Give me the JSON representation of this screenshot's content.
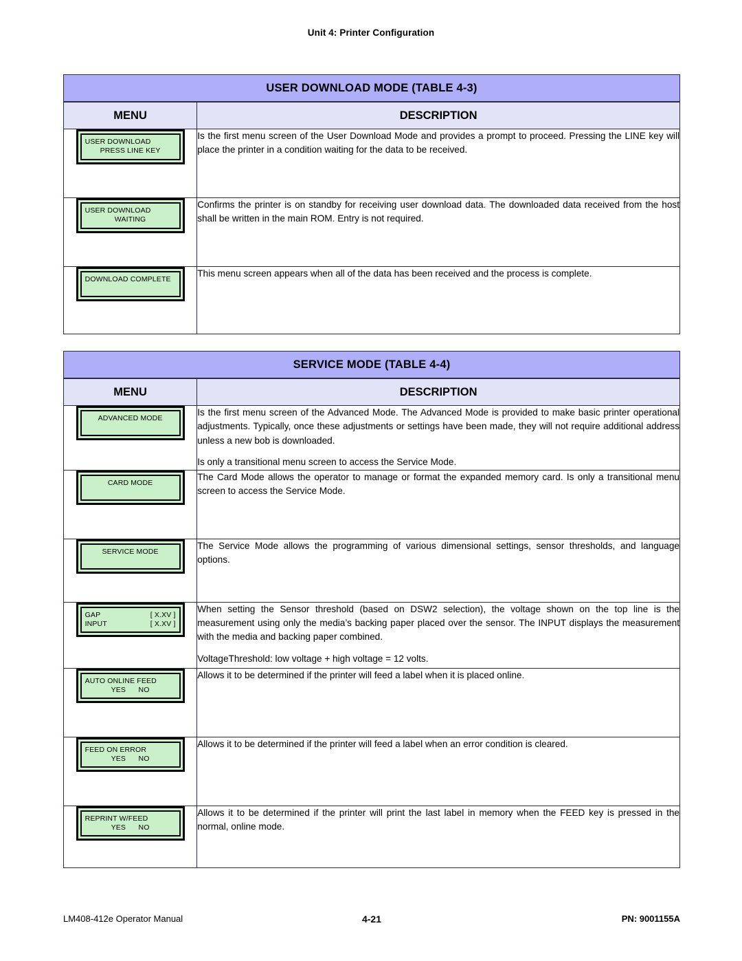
{
  "running_head": "Unit 4:  Printer Configuration",
  "colors": {
    "title_bar": "#aeaef9",
    "subhead": "#e3e3f8",
    "lcd_green": "#c9f0c9",
    "border": "#2b2b40"
  },
  "tables": [
    {
      "title": "USER DOWNLOAD MODE (TABLE 4-3)",
      "columns": {
        "menu": "MENU",
        "description": "DESCRIPTION"
      },
      "rows": [
        {
          "lcd": {
            "lines": [
              {
                "text": "USER DOWNLOAD",
                "align": "left"
              },
              {
                "text": "PRESS LINE KEY",
                "align": "center"
              }
            ]
          },
          "paragraphs": [
            "Is the first menu screen of the User Download Mode and provides a prompt to proceed. Pressing the LINE key will place the printer in a condition waiting for the data to be received."
          ]
        },
        {
          "lcd": {
            "lines": [
              {
                "text": "USER DOWNLOAD",
                "align": "left"
              },
              {
                "text": "WAITING",
                "align": "center"
              }
            ]
          },
          "paragraphs": [
            "Confirms the printer is on standby for receiving user download data. The downloaded data received from the host shall be written in the main ROM. Entry is not required."
          ]
        },
        {
          "lcd": {
            "lines": [
              {
                "text": "DOWNLOAD COMPLETE",
                "align": "left"
              },
              {
                "text": "",
                "align": "left"
              }
            ]
          },
          "paragraphs": [
            "This menu screen appears when all of the data has been received and the process is complete."
          ]
        }
      ]
    },
    {
      "title": "SERVICE MODE (TABLE 4-4)",
      "columns": {
        "menu": "MENU",
        "description": "DESCRIPTION"
      },
      "rows": [
        {
          "lcd": {
            "lines": [
              {
                "text": "ADVANCED MODE",
                "align": "center"
              },
              {
                "text": "",
                "align": "left"
              }
            ]
          },
          "paragraphs": [
            "Is the first menu screen of the Advanced Mode. The Advanced Mode is provided to make basic printer operational adjustments. Typically, once these adjustments or settings have been made, they will not require additional address unless a new bob is downloaded.",
            "Is only a transitional menu screen to access the Service Mode."
          ]
        },
        {
          "lcd": {
            "lines": [
              {
                "text": "CARD MODE",
                "align": "center"
              },
              {
                "text": "",
                "align": "left"
              }
            ]
          },
          "paragraphs": [
            "The Card Mode allows the operator to manage or format the expanded memory card. Is only a transitional menu screen to access the Service Mode."
          ]
        },
        {
          "lcd": {
            "lines": [
              {
                "text": "SERVICE MODE",
                "align": "center"
              },
              {
                "text": "",
                "align": "left"
              }
            ]
          },
          "paragraphs": [
            "The Service Mode allows the programming of various dimensional settings, sensor thresholds, and language options."
          ]
        },
        {
          "lcd": {
            "lines": [
              {
                "left": "GAP",
                "right": "[ X.XV ]",
                "align": "split"
              },
              {
                "left": "INPUT",
                "right": "[ X.XV ]",
                "align": "split"
              }
            ]
          },
          "paragraphs": [
            "When setting the Sensor threshold (based on DSW2 selection), the voltage shown on the top line is the measurement using only the media’s backing paper placed over the sensor. The INPUT displays the measurement with the media and backing paper combined.",
            "VoltageThreshold: low voltage + high voltage = 12 volts."
          ]
        },
        {
          "lcd": {
            "lines": [
              {
                "text": "AUTO ONLINE FEED",
                "align": "left"
              },
              {
                "text": "YES      NO",
                "align": "center"
              }
            ]
          },
          "paragraphs": [
            "Allows it to be determined if the printer will feed a label when it is placed online."
          ]
        },
        {
          "lcd": {
            "lines": [
              {
                "text": "FEED ON ERROR",
                "align": "left"
              },
              {
                "text": "YES      NO",
                "align": "center"
              }
            ]
          },
          "paragraphs": [
            "Allows it to be determined if the printer will feed a label when an error condition is cleared."
          ]
        },
        {
          "lcd": {
            "lines": [
              {
                "text": "REPRINT W/FEED",
                "align": "left"
              },
              {
                "text": "YES      NO",
                "align": "center"
              }
            ]
          },
          "paragraphs": [
            "Allows it to be determined if the printer will print the last label in memory when the FEED key is pressed in the normal, online mode."
          ]
        }
      ]
    }
  ],
  "footer": {
    "left": "LM408-412e Operator Manual",
    "page": "4-21",
    "right": "PN: 9001155A"
  }
}
